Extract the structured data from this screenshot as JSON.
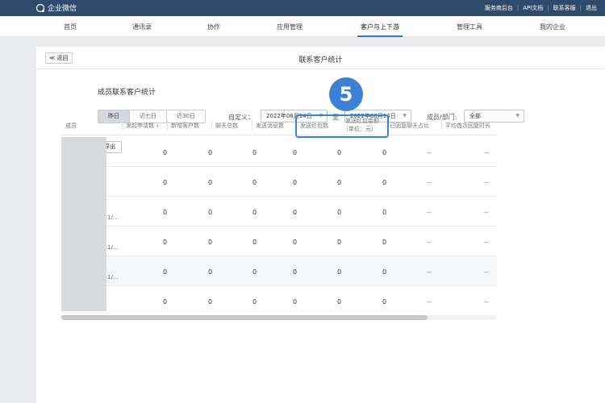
{
  "topbar": {
    "logo_text": "企业微信",
    "links": [
      "服务商后台",
      "API文档",
      "联系客服",
      "退出"
    ]
  },
  "nav": {
    "items": [
      "首页",
      "通讯录",
      "协作",
      "应用管理",
      "客户与上下游",
      "管理工具",
      "我的企业"
    ],
    "active_index": 4
  },
  "panel": {
    "back_label": "≪ 返回",
    "title": "联系客户统计",
    "section_title": "成员联系客户统计"
  },
  "filters": {
    "range_tabs": [
      "昨日",
      "近七日",
      "近30日"
    ],
    "active_tab": 0,
    "custom_label": "自定义：",
    "start_date": "2022年08月14日",
    "to_label": "至",
    "end_date": "2022年08月14日",
    "member_label": "成员/部门:",
    "member_value": "全部"
  },
  "export_label": "导出",
  "table": {
    "headers": [
      "成员",
      "发起申请数",
      "新增客户数",
      "聊天总数",
      "发送消息数",
      "发送红包数",
      "发送红包金额",
      "（单位：元）",
      "已回复聊天占比",
      "平均首次回复时长"
    ],
    "rows": [
      {
        "member": "",
        "values": [
          "0",
          "0",
          "0",
          "0",
          "0",
          "0",
          "--",
          "--"
        ]
      },
      {
        "member": "",
        "values": [
          "0",
          "0",
          "0",
          "0",
          "0",
          "0",
          "--",
          "--"
        ]
      },
      {
        "member": "1/...",
        "values": [
          "0",
          "0",
          "0",
          "0",
          "0",
          "0",
          "--",
          "--"
        ]
      },
      {
        "member": "1/...",
        "values": [
          "0",
          "0",
          "0",
          "0",
          "0",
          "0",
          "--",
          "--"
        ]
      },
      {
        "member": "1/...",
        "values": [
          "0",
          "0",
          "0",
          "0",
          "0",
          "0",
          "--",
          "--"
        ]
      },
      {
        "member": "",
        "values": [
          "0",
          "0",
          "0",
          "0",
          "0",
          "0",
          "--",
          "--"
        ]
      }
    ]
  },
  "annotation": {
    "step_number": "5",
    "color": "#3b82d6"
  },
  "colors": {
    "topbar": "#2f4a6b",
    "nav_active": "#2f76d4"
  }
}
